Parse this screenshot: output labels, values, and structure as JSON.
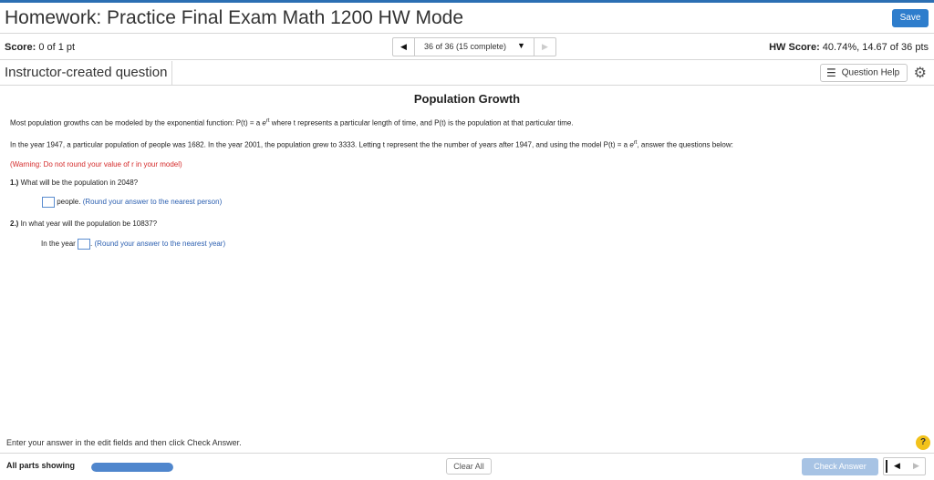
{
  "header": {
    "title": "Homework: Practice Final Exam Math 1200 HW Mode",
    "save_label": "Save"
  },
  "score_bar": {
    "score_label": "Score:",
    "score_value": "0 of 1 pt",
    "nav_text": "36 of 36 (15 complete)",
    "hw_score_label": "HW Score:",
    "hw_score_value": "40.74%, 14.67 of 36 pts"
  },
  "question_header": {
    "label": "Instructor-created question",
    "help_label": "Question Help"
  },
  "question": {
    "title": "Population Growth",
    "intro_pre": "Most population growths can be modeled by the exponential function:  P(t)  =  a",
    "intro_post": " where t represents a particular length of time, and P(t) is the population at that particular time.",
    "setup_pre": "In the year 1947, a particular population of people was 1682.  In the year 2001, the population grew to 3333.  Letting t represent the the number of years after 1947, and using the model  P(t)  =  a",
    "setup_post": ", answer the questions below:",
    "exp_e": "e",
    "exp_rt": "rt",
    "warning": "(Warning:  Do not round your value of r in your model)",
    "part1_num": "1.)",
    "part1_text": "What will be the population in 2048?",
    "part1_unit": "people.",
    "part1_hint": "(Round your answer to the nearest person)",
    "part2_num": "2.)",
    "part2_text": "In what year will the population be 10837?",
    "part2_prefix": "In the year",
    "part2_hint": "(Round your answer to the nearest year)"
  },
  "footer": {
    "hint": "Enter your answer in the edit fields and then click Check Answer.",
    "parts_label": "All parts showing",
    "progress_fraction": 1.0,
    "clear_label": "Clear All",
    "check_label": "Check Answer",
    "help_symbol": "?"
  },
  "colors": {
    "accent": "#2e7dcc",
    "warning": "#d42a2a",
    "hint_blue": "#2b5fb0",
    "help_yellow": "#f2c21b"
  }
}
